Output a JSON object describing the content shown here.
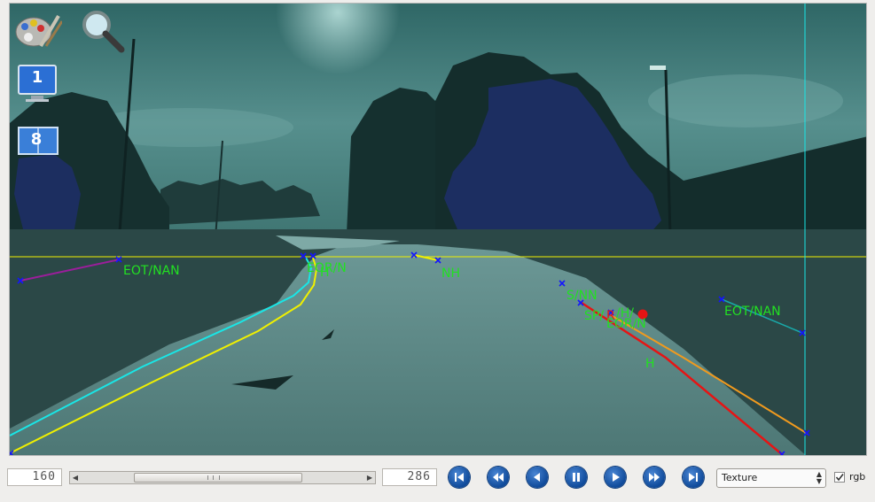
{
  "overlay_labels": {
    "left_eot": "EOT/NAN",
    "center_eor": "EOR/N",
    "center_h": "H",
    "center_nh": "NH",
    "right_sn": "S/NN",
    "right_sp": "SP/",
    "right_r": "R",
    "right_h1": "/H/",
    "right_eor": "EOR/N",
    "right_h2": "H",
    "far_eot": "EOT/NAN"
  },
  "toolbar": {
    "palette_icon": "paint-palette-icon",
    "search_icon": "magnifier-icon",
    "monitor_label": "1",
    "window_label": "8"
  },
  "player": {
    "current_frame": "160",
    "total_frames": "286",
    "progress": 0.46,
    "mode_value": "Texture",
    "rgb_label": "rgb",
    "rgb_checked": true
  },
  "colors": {
    "label_green": "#22e022",
    "marker_blue": "#1414ff",
    "cyan_line": "#19e6e6",
    "yellow_line": "#f0f000",
    "red_line": "#e61414",
    "orange_line": "#f09a1e",
    "purple_line": "#9b1e9b",
    "button_blue": "#0f4a9a"
  }
}
